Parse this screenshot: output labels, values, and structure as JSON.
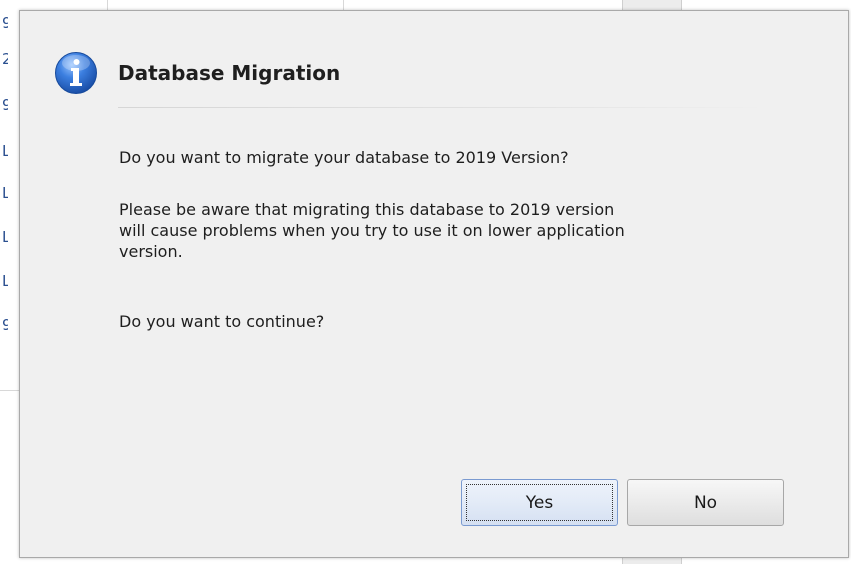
{
  "dialog": {
    "title": "Database Migration",
    "icon": "info-icon",
    "message_lines": [
      "Do you want to migrate your database to 2019 Version?",
      "Please be aware that migrating this database to 2019 version",
      "will cause problems when you try to use it on lower application",
      "version.",
      "Do you want to continue?"
    ],
    "buttons": {
      "yes_label": "Yes",
      "no_label": "No"
    }
  },
  "background": {
    "row_marks": [
      "9",
      "2",
      "9",
      "L",
      "L",
      "L",
      "L",
      "9"
    ]
  },
  "colors": {
    "dialog_bg": "#f0f0f0",
    "icon_blue": "#2f6fd0",
    "focus_button_border": "#7a9ad0"
  }
}
